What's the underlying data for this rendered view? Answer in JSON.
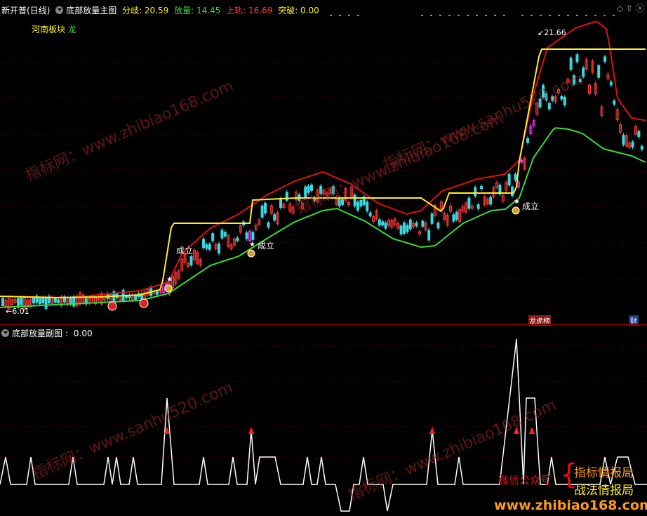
{
  "main": {
    "stock_name": "新开普",
    "period": "(日线)",
    "indicator": "底部放量主图",
    "fenqi_label": "分歧: 20.59",
    "fangliang_label": "放量: 14.45",
    "shangui_label": "上轨: 16.69",
    "tupo_label": "突破: 0.00",
    "sector": "河南板块",
    "sector_suffix": "龙",
    "high_price": "21.66",
    "low_price": "6.01",
    "signal_label": "成立",
    "tag_bang": "龙虎榜",
    "tag_cai": "财"
  },
  "sub": {
    "indicator": "底部放量副图",
    "value_label": "0.00"
  },
  "watermark": {
    "text1": "指标网：www.zhibiao168.com",
    "text2": "指标网：www.sanhu520.com"
  },
  "brand": {
    "wechat": "微信公众号",
    "name1": "指标情报局",
    "name2": "战法情报局",
    "url": "www.zhibiao168.com"
  },
  "colors": {
    "up": "#ff3a3a",
    "down": "#37d8e0",
    "magenta": "#ff33ff",
    "red_line": "#e01010",
    "yellow_line": "#ffee22",
    "green_line": "#33dd33",
    "orange": "#ff9a1a"
  }
}
